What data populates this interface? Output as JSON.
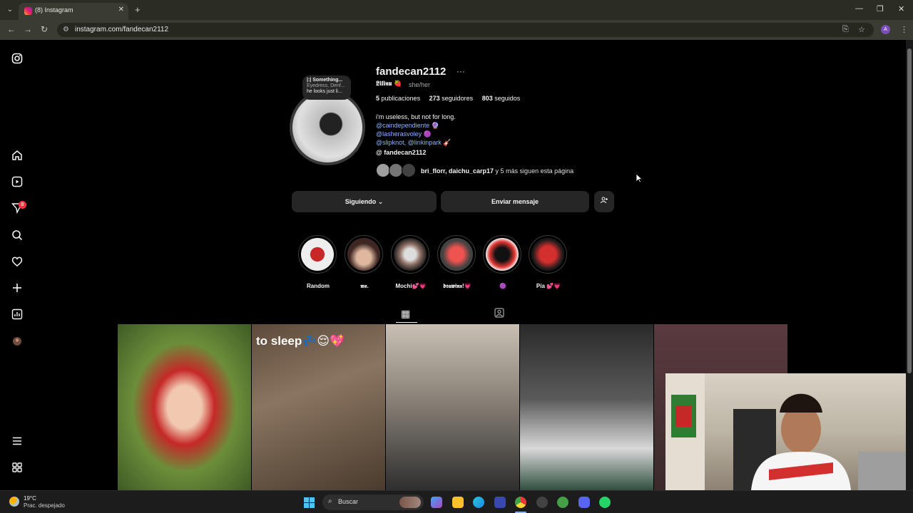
{
  "browser": {
    "tab_title": "(8) Instagram",
    "url": "instagram.com/fandecan2112",
    "profile_initial": "A"
  },
  "sidebar": {
    "notification_count": "8"
  },
  "note": {
    "line1": "|:| Something...",
    "line2": "Eyedress, Denf...",
    "line3": "he looks just li..."
  },
  "profile": {
    "username": "fandecan2112",
    "full_name": "𝕷𝖎𝖑𝖎𝖓𝖚 🍓",
    "pronouns": "she/her",
    "posts_count": "5",
    "posts_label": "publicaciones",
    "followers_count": "273",
    "followers_label": "seguidores",
    "following_count": "803",
    "following_label": "seguidos",
    "bio_line1": "i'm useless, but not for long.",
    "bio_mention1": "@caindependiente 🔮",
    "bio_mention2": "@lasherasvoley 🟣",
    "bio_mention3a": "@slipknot",
    "bio_sep": ", ",
    "bio_mention3b": "@linkinpark",
    "bio_mention3_emoji": " 🎸",
    "threads_handle": "fandecan2112",
    "followed_by_names": "bri_florr, daichu_carp17",
    "followed_by_rest": " y 5 más siguen esta página"
  },
  "actions": {
    "following_label": "Siguiendo",
    "message_label": "Enviar mensaje"
  },
  "highlights": [
    {
      "label": "Random",
      "color": "#b71c1c"
    },
    {
      "label": "𝖒𝖊.",
      "color": "#5d4037"
    },
    {
      "label": "Mochi💕💗",
      "color": "#9e9e9e"
    },
    {
      "label": "𝖉𝖗𝖆𝖜𝖎𝖓𝖘!💗",
      "color": "#c62828"
    },
    {
      "label": "🟣",
      "color": "#ef5350"
    },
    {
      "label": "Pía 💕💗",
      "color": "#d32f2f"
    }
  ],
  "posts": [
    {
      "caption": "",
      "color": "#5b7a3a"
    },
    {
      "caption": "to sleep💤😌💖",
      "color": "#6d5d4b"
    },
    {
      "caption": "",
      "color": "#8a8278"
    },
    {
      "caption": "",
      "color": "#4a4a4a"
    },
    {
      "caption": "",
      "color": "#5a3a3e"
    }
  ],
  "taskbar": {
    "temperature": "19°C",
    "weather_desc": "Prac. despejado",
    "search_label": "Buscar"
  }
}
